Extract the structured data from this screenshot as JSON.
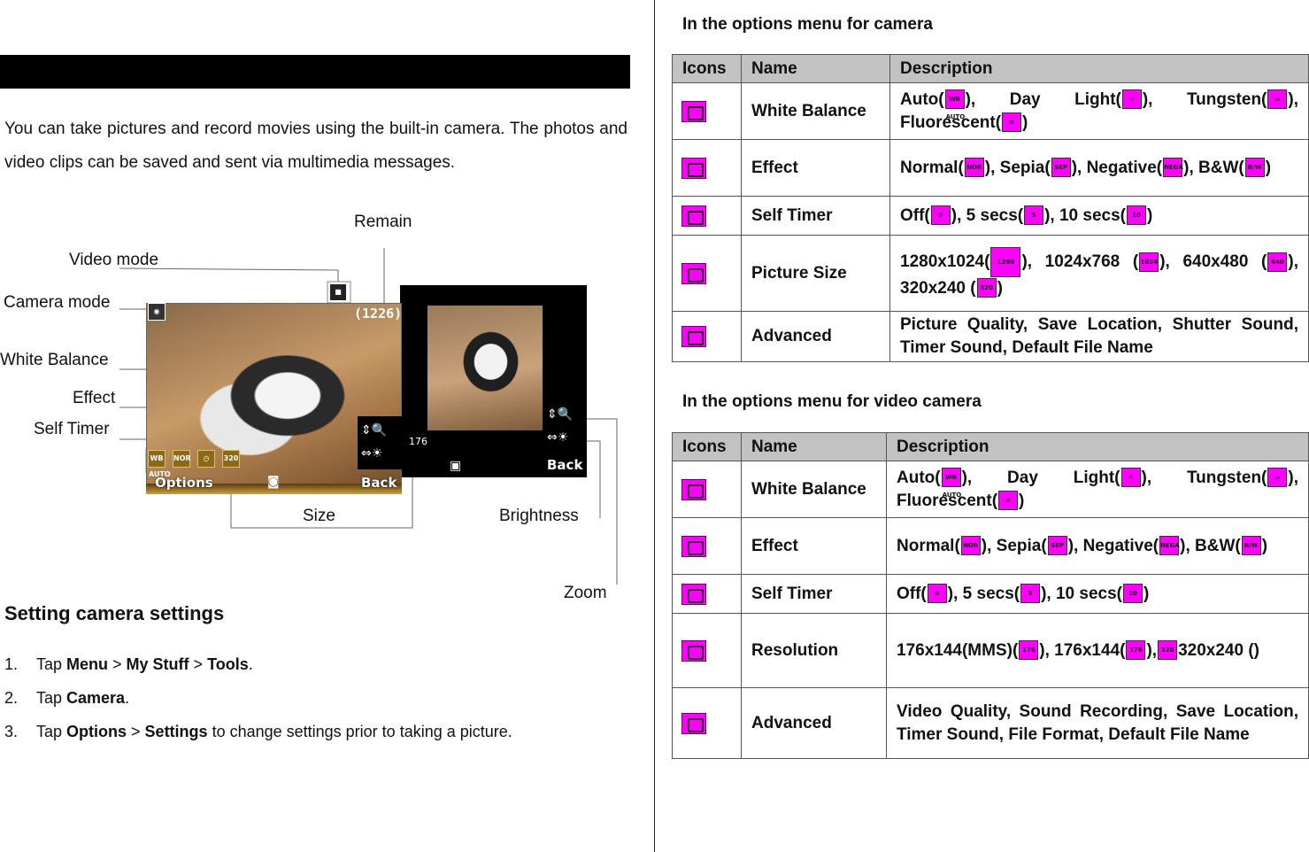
{
  "left": {
    "intro": "You can take pictures and record movies using the built-in camera. The photos and video clips can be saved and sent via multimedia messages.",
    "figure": {
      "callouts": {
        "remain": "Remain",
        "video_mode": "Video mode",
        "camera_mode": "Camera mode",
        "white_balance": "White Balance",
        "effect": "Effect",
        "self_timer": "Self Timer",
        "size": "Size",
        "brightness": "Brightness",
        "zoom": "Zoom"
      },
      "screen": {
        "counter": "(1226)",
        "options_softkey": "Options",
        "back_softkey": "Back",
        "back_softkey_rear": "Back",
        "size_badge": "320",
        "wb_badge": "WB AUTO",
        "effect_badge": "NOR",
        "rear_res_badge": "176"
      }
    },
    "settings_heading": "Setting camera settings",
    "steps": [
      {
        "num": "1.",
        "pre": "Tap ",
        "b1": "Menu",
        "s1": " > ",
        "b2": "My Stuff",
        "s2": " > ",
        "b3": "Tools",
        "post": "."
      },
      {
        "num": "2.",
        "pre": "Tap ",
        "b1": "Camera",
        "post": "."
      },
      {
        "num": "3.",
        "pre": "Tap ",
        "b1": "Options",
        "s1": " > ",
        "b2": "Settings",
        "post": " to change settings prior to taking a picture."
      }
    ]
  },
  "camera_table": {
    "title": "In the options menu for camera",
    "headers": [
      "Icons",
      "Name",
      "Description"
    ],
    "rows": [
      {
        "icon": "white-balance-icon",
        "name": "White Balance",
        "d": [
          "Auto(",
          "), Day Light(",
          "), Tungsten(",
          "), Fluorescent(",
          ")"
        ],
        "ic": [
          "WB AUTO",
          "☼",
          "⌂",
          "≡"
        ]
      },
      {
        "icon": "effect-icon",
        "name": "Effect",
        "d": [
          "Normal(",
          "), Sepia(",
          "), Negative(",
          "), B&W(",
          ")"
        ],
        "ic": [
          "NOR",
          "SEP",
          "NEGA",
          "B/W"
        ]
      },
      {
        "icon": "self-timer-icon",
        "name": "Self Timer",
        "d": [
          "Off(",
          "), 5 secs(",
          "), 10 secs(",
          ")"
        ],
        "ic": [
          "⊘",
          "5",
          "10"
        ]
      },
      {
        "icon": "picture-size-icon",
        "name": "Picture Size",
        "d": [
          "1280x1024(",
          "), 1024x768 (",
          "), 640x480 (",
          "), 320x240 (",
          ")"
        ],
        "ic": [
          "1280",
          "1024",
          "640",
          "320"
        ]
      },
      {
        "icon": "advanced-icon",
        "name": "Advanced",
        "text": "Picture Quality, Save Location, Shutter Sound, Timer Sound, Default File Name"
      }
    ]
  },
  "video_table": {
    "title": "In the options menu for video camera",
    "headers": [
      "Icons",
      "Name",
      "Description"
    ],
    "rows": [
      {
        "icon": "white-balance-icon",
        "name": "White Balance",
        "d": [
          "Auto(",
          "), Day Light(",
          "), Tungsten(",
          "), Fluorescent(",
          ")"
        ],
        "ic": [
          "WB AUTO",
          "☼",
          "⌂",
          "≡"
        ]
      },
      {
        "icon": "effect-icon",
        "name": "Effect",
        "d": [
          "Normal(",
          "), Sepia(",
          "), Negative(",
          "), B&W(",
          ")"
        ],
        "ic": [
          "NOR",
          "SEP",
          "NEGA",
          "B/W"
        ]
      },
      {
        "icon": "self-timer-icon",
        "name": "Self Timer",
        "d": [
          "Off(",
          "), 5 secs(",
          "), 10 secs(",
          ")"
        ],
        "ic": [
          "⊘",
          "5",
          "10"
        ]
      },
      {
        "icon": "resolution-icon",
        "name": "Resolution",
        "d": [
          "176x144(MMS)(",
          "), 176x144(",
          "),",
          "320x240 (",
          ")"
        ],
        "ic": [
          "176",
          "176",
          "320"
        ]
      },
      {
        "icon": "advanced-icon",
        "name": "Advanced",
        "text": "Video Quality, Sound Recording, Save Location, Timer Sound, File Format, Default File Name"
      }
    ]
  },
  "colors": {
    "icon_magenta": "#ff00ff",
    "header_gray": "#c2c2c2",
    "bar_black": "#000000"
  }
}
